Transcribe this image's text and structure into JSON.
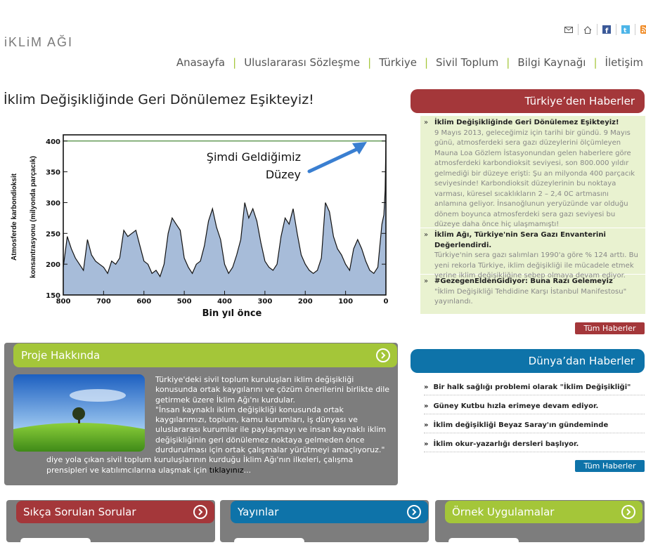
{
  "site": {
    "logo": "iKLiM AĞI"
  },
  "header_icons": [
    "envelope-icon",
    "home-icon",
    "facebook-icon",
    "twitter-icon",
    "rss-icon"
  ],
  "nav": [
    "Anasayfa",
    "Uluslararası Sözleşme",
    "Türkiye",
    "Sivil Toplum",
    "Bilgi Kaynağı",
    "İletişim"
  ],
  "main": {
    "headline": "İklim Değişikliğinde Geri Dönülemez Eşikteyiz!"
  },
  "chart_data": {
    "type": "area",
    "title": "",
    "xlabel": "Bin yıl önce",
    "ylabel_line1": "Atmosferde karbondioksit",
    "ylabel_line2": "konsantrasyonu (milyonda parçacık)",
    "annotation_line1": "Şimdi Geldiğimiz",
    "annotation_line2": "Düzey",
    "xlim": [
      800,
      0
    ],
    "ylim": [
      150,
      410
    ],
    "x_ticks": [
      "800",
      "700",
      "600",
      "500",
      "400",
      "300",
      "200",
      "100",
      "0"
    ],
    "y_ticks": [
      "150",
      "200",
      "250",
      "300",
      "350",
      "400"
    ],
    "reference_line": 400,
    "x": [
      800,
      790,
      780,
      770,
      760,
      750,
      740,
      730,
      720,
      710,
      700,
      690,
      680,
      670,
      660,
      650,
      640,
      630,
      620,
      610,
      600,
      590,
      580,
      570,
      560,
      550,
      540,
      530,
      520,
      510,
      500,
      490,
      480,
      470,
      460,
      450,
      440,
      430,
      420,
      410,
      400,
      390,
      380,
      370,
      360,
      350,
      340,
      330,
      320,
      310,
      300,
      290,
      280,
      270,
      260,
      250,
      240,
      230,
      220,
      210,
      200,
      190,
      180,
      170,
      160,
      150,
      140,
      130,
      120,
      110,
      100,
      90,
      80,
      70,
      60,
      50,
      40,
      30,
      20,
      15,
      10,
      5,
      2,
      0
    ],
    "y": [
      195,
      245,
      225,
      210,
      200,
      190,
      240,
      215,
      205,
      200,
      195,
      185,
      205,
      200,
      210,
      255,
      245,
      250,
      255,
      230,
      205,
      200,
      185,
      190,
      180,
      200,
      250,
      275,
      265,
      255,
      210,
      195,
      185,
      200,
      205,
      230,
      270,
      290,
      260,
      240,
      200,
      185,
      195,
      215,
      240,
      300,
      275,
      290,
      270,
      235,
      205,
      195,
      190,
      200,
      245,
      275,
      265,
      290,
      250,
      215,
      200,
      190,
      185,
      190,
      210,
      300,
      285,
      245,
      225,
      215,
      200,
      190,
      225,
      240,
      225,
      205,
      190,
      185,
      195,
      230,
      265,
      280,
      320,
      400
    ]
  },
  "turkey_news": {
    "title": "Türkiye’den Haberler",
    "items": [
      {
        "title": "İklim Değişikliğinde Geri Dönülemez Eşikteyiz!",
        "desc": "9 Mayıs 2013, geleceğimiz için tarihi bir gündü. 9 Mayıs günü, atmosferdeki sera gazı düzeylerini ölçümleyen Mauna Loa Gözlem İstasyonundan gelen haberlere göre atmosferdeki karbondioksit seviyesi, son 800.000 yıldır gelmediği bir düzeye erişti: Şu an milyonda 400 parçacık seviyesinde! Karbondioksit düzeylerinin bu noktaya varması, küresel sıcaklıkların 2 – 2,4 0C artmasını anlamına geliyor. İnsanoğlunun yeryüzünde var olduğu dönem boyunca atmosferdeki sera gazı seviyesi bu düzeye daha önce hiç ulaşmamıştı!"
      },
      {
        "title": "İklim Ağı, Türkiye'nin Sera Gazı Envanterini Değerlendirdi.",
        "desc": "Türkiye'nin sera gazı salımları 1990'a göre % 124 arttı. Bu yeni rekorla Türkiye, iklim değişikliği ile mücadele etmek yerine iklim değişikliğine sebep olmaya devam ediyor."
      },
      {
        "title": "#GezegenEldenGidiyor: Buna Razı Gelemeyiz",
        "desc": "\"İklim Değişikliği Tehdidine Karşı İstanbul Manifestosu\" yayınlandı."
      }
    ],
    "button": "Tüm Haberler"
  },
  "world_news": {
    "title": "Dünya’dan Haberler",
    "items": [
      "Bir halk sağlığı problemi olarak \"İklim Değişikliği\"",
      "Güney Kutbu hızla erimeye devam ediyor.",
      "İklim değişikliği Beyaz Saray'ın gündeminde",
      "İklim okur-yazarlığı dersleri başlıyor."
    ],
    "button": "Tüm Haberler"
  },
  "project": {
    "title": "Proje Hakkında",
    "text1": " Türkiye'deki sivil toplum kuruluşları iklim değişikliği konusunda ortak kaygılarını ve çözüm önerilerini birlikte dile getirmek üzere İklim Ağı'nı kurdular.",
    "text2": "\"İnsan kaynaklı iklim değişikliği konusunda ortak kaygılarımızı, toplum, kamu kurumları, iş dünyası ve uluslararası kurumlar ile paylaşmayı ve insan kaynaklı iklim değişikliğinin geri dönülemez noktaya gelmeden önce durdurulması için ortak çalışmalar yürütmeyi amaçlıyoruz.\"",
    "text3": "diye yola çıkan sivil toplum kuruluşlarının kurduğu İklim Ağı'nın ilkeleri, çalışma prensipleri ve katılımcılarına ulaşmak için ",
    "link": "tıklayınız",
    "ellipsis": "..."
  },
  "bottom": [
    "Sıkça Sorulan Sorular",
    "Yayınlar",
    "Örnek Uygulamalar"
  ],
  "colors": {
    "red": "#a4373a",
    "blue": "#0e73a9",
    "green": "#a4c639",
    "gray": "#7d7d7d",
    "lightgreen": "#e9f2d0"
  }
}
